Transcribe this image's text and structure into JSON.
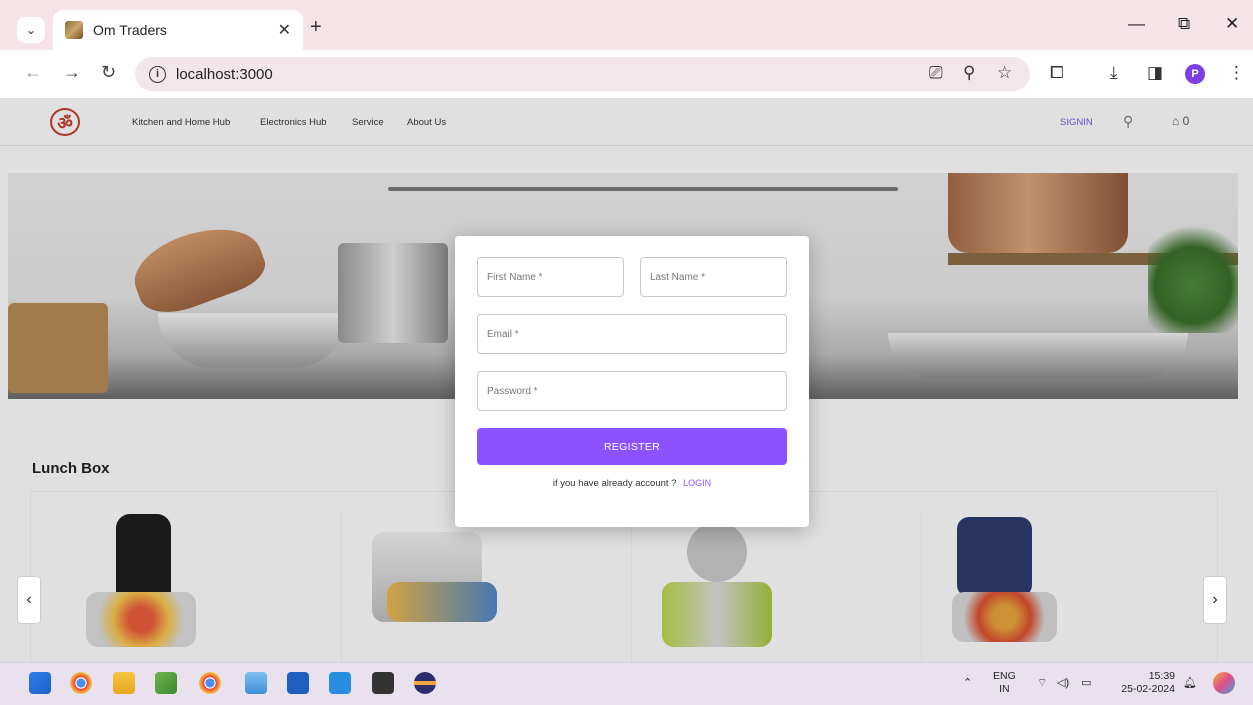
{
  "browser": {
    "tab_title": "Om Traders",
    "url": "localhost:3000",
    "profile_initial": "P"
  },
  "site": {
    "nav_links": [
      "Kitchen and Home Hub",
      "Electronics Hub",
      "Service",
      "About Us"
    ],
    "signin_label": "SIGNIN",
    "cart_count": "0"
  },
  "section": {
    "title": "Lunch Box"
  },
  "register_form": {
    "first_name_placeholder": "First Name *",
    "last_name_placeholder": "Last Name *",
    "email_placeholder": "Email *",
    "password_placeholder": "Password *",
    "register_label": "REGISTER",
    "login_prompt": "if you have already account ?",
    "login_label": "LOGIN",
    "accent_color": "#8c52ff"
  },
  "taskbar": {
    "lang_top": "ENG",
    "lang_bottom": "IN",
    "time": "15:39",
    "date": "25-02-2024"
  }
}
